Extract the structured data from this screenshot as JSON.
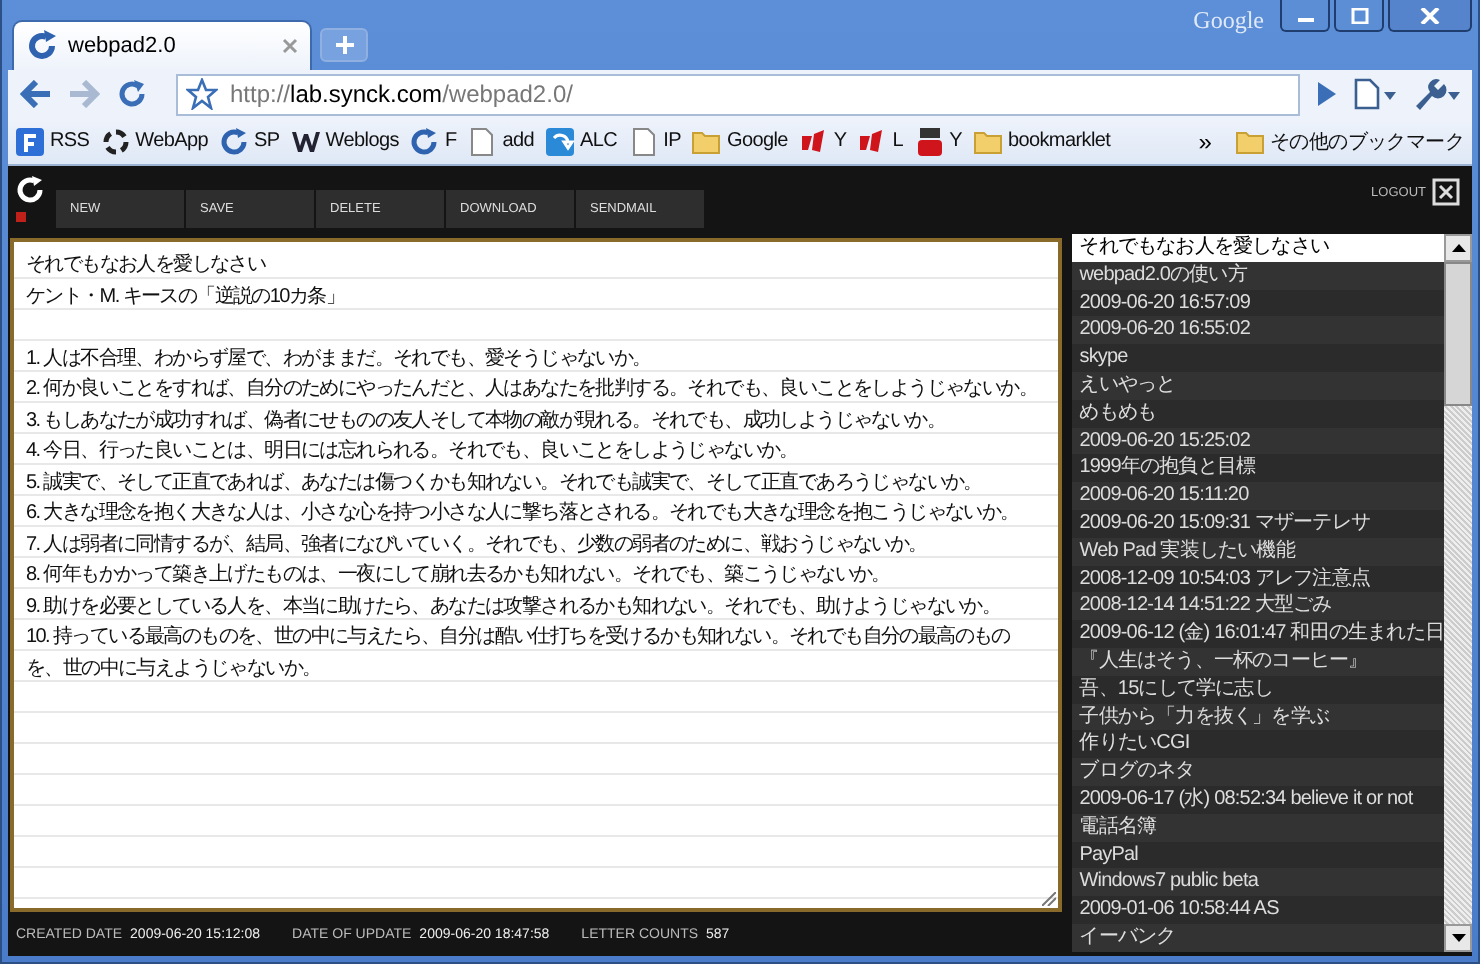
{
  "window": {
    "brand": "Google"
  },
  "tabs": [
    {
      "title": "webpad2.0",
      "selected": true
    }
  ],
  "toolbar": {
    "url_scheme": "http://",
    "url_host": "lab.synck.com",
    "url_path": "/webpad2.0/"
  },
  "bookmarks": [
    {
      "label": "RSS",
      "kind": "feed"
    },
    {
      "label": "WebApp",
      "kind": "ring"
    },
    {
      "label": "SP",
      "kind": "reload"
    },
    {
      "label": "Weblogs",
      "kind": "w"
    },
    {
      "label": "F",
      "kind": "reload"
    },
    {
      "label": "add",
      "kind": "page"
    },
    {
      "label": "ALC",
      "kind": "blue"
    },
    {
      "label": "IP",
      "kind": "page"
    },
    {
      "label": "Google",
      "kind": "folder"
    },
    {
      "label": "Y",
      "kind": "red"
    },
    {
      "label": "L",
      "kind": "red"
    },
    {
      "label": "Y",
      "kind": "tube"
    },
    {
      "label": "bookmarklet",
      "kind": "folder"
    }
  ],
  "bookmarks_overflow": "»",
  "other_bookmarks": "その他のブックマーク",
  "app": {
    "logout": "LOGOUT",
    "buttons": [
      "NEW",
      "SAVE",
      "DELETE",
      "DOWNLOAD",
      "SENDMAIL"
    ]
  },
  "editor": {
    "blocks": [
      {
        "lines": [
          "それでもなお人を愛しなさい",
          "ケント・M. キースの「逆説の10カ条」"
        ]
      },
      {
        "lines": [
          "1. 人は不合理、わからず屋で、わがままだ。それでも、愛そうじゃないか。",
          "2. 何か良いことをすれば、自分のためにやったんだと、人はあなたを批判する。それでも、良いことをしようじゃないか。",
          "3. もしあなたが成功すれば、偽者にせものの友人そして本物の敵が現れる。それでも、成功しようじゃないか。",
          "4. 今日、行った良いことは、明日には忘れられる。それでも、良いことをしようじゃないか。",
          "5. 誠実で、そして正直であれば、あなたは傷つくかも知れない。それでも誠実で、そして正直であろうじゃないか。",
          "6. 大きな理念を抱く大きな人は、小さな心を持つ小さな人に撃ち落とされる。それでも大きな理念を抱こうじゃないか。",
          "7. 人は弱者に同情するが、結局、強者になびいていく。それでも、少数の弱者のために、戦おうじゃないか。",
          "8. 何年もかかって築き上げたものは、一夜にして崩れ去るかも知れない。それでも、築こうじゃないか。",
          "9. 助けを必要としている人を、本当に助けたら、あなたは攻撃されるかも知れない。それでも、助けようじゃないか。",
          "10. 持っている最高のものを、世の中に与えたら、自分は酷い仕打ちを受けるかも知れない。それでも自分の最高のものを、世の中に与えようじゃないか。"
        ]
      }
    ]
  },
  "footer": [
    {
      "label": "CREATED DATE",
      "value": "2009-06-20 15:12:08"
    },
    {
      "label": "DATE OF UPDATE",
      "value": "2009-06-20 18:47:58"
    },
    {
      "label": "LETTER COUNTS",
      "value": "587"
    }
  ],
  "notes": [
    {
      "title": "それでもなお人を愛しなさい",
      "selected": true
    },
    {
      "title": "webpad2.0の使い方",
      "selected": false
    },
    {
      "title": "2009-06-20 16:57:09",
      "selected": false
    },
    {
      "title": "2009-06-20 16:55:02",
      "selected": false
    },
    {
      "title": "skype",
      "selected": false
    },
    {
      "title": "えいやっと",
      "selected": false
    },
    {
      "title": "めもめも",
      "selected": false
    },
    {
      "title": "2009-06-20 15:25:02",
      "selected": false
    },
    {
      "title": "1999年の抱負と目標",
      "selected": false
    },
    {
      "title": "2009-06-20 15:11:20",
      "selected": false
    },
    {
      "title": "2009-06-20 15:09:31 マザーテレサ",
      "selected": false
    },
    {
      "title": "Web Pad 実装したい機能",
      "selected": false
    },
    {
      "title": "2008-12-09 10:54:03 アレフ注意点",
      "selected": false
    },
    {
      "title": "2008-12-14 14:51:22 大型ごみ",
      "selected": false
    },
    {
      "title": "2009-06-12 (金) 16:01:47 和田の生まれた日",
      "selected": false
    },
    {
      "title": "『人生はそう、一杯のコーヒー』",
      "selected": false
    },
    {
      "title": "吾、15にして学に志し",
      "selected": false
    },
    {
      "title": "子供から「力を抜く」を学ぶ",
      "selected": false
    },
    {
      "title": "作りたいCGI",
      "selected": false
    },
    {
      "title": "ブログのネタ",
      "selected": false
    },
    {
      "title": "2009-06-17 (水) 08:52:34 believe it or not",
      "selected": false
    },
    {
      "title": "電話名簿",
      "selected": false
    },
    {
      "title": "PayPal",
      "selected": false
    },
    {
      "title": "Windows7 public beta",
      "selected": false
    },
    {
      "title": "2009-01-06 10:58:44 AS",
      "selected": false
    },
    {
      "title": "イーバンク",
      "selected": false
    }
  ]
}
